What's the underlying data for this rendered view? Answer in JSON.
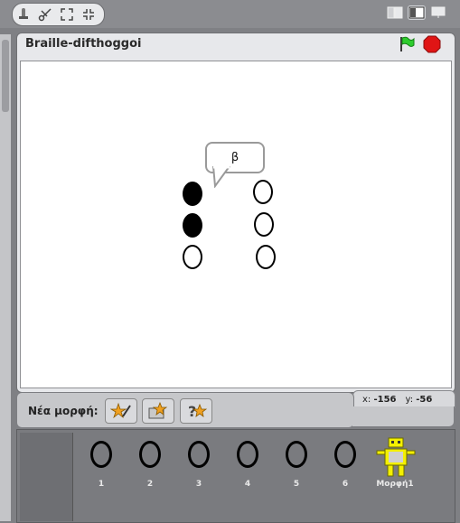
{
  "toolbar": {
    "tools": [
      "stamp-icon",
      "scissors-icon",
      "grow-icon",
      "shrink-icon"
    ],
    "view_modes": [
      "small-stage-icon",
      "normal-stage-icon",
      "presentation-icon"
    ]
  },
  "stage": {
    "title": "Braille-difthoggoi",
    "speech": "β",
    "dots": [
      true,
      false,
      true,
      false,
      false,
      false
    ],
    "coords": {
      "x_label": "x:",
      "x_value": "-156",
      "y_label": "y:",
      "y_value": "-56"
    }
  },
  "new_sprite": {
    "label": "Νέα μορφή:",
    "buttons": [
      "paint-sprite-icon",
      "choose-sprite-file-icon",
      "random-sprite-icon"
    ]
  },
  "sprites": [
    "1",
    "2",
    "3",
    "4",
    "5",
    "6",
    "Μορφή1"
  ],
  "colors": {
    "flag": "#2ecc2e",
    "stop": "#e01515",
    "sprite_yellow": "#f4f000"
  }
}
